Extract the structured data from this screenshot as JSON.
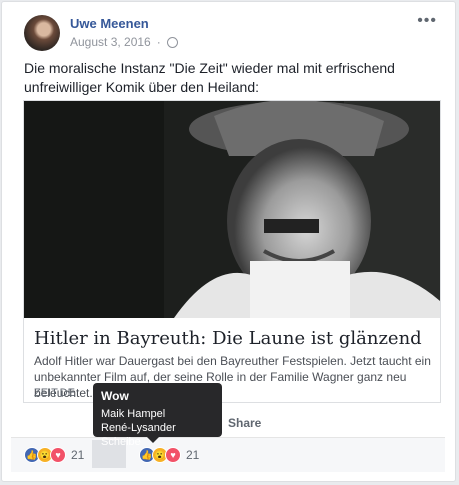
{
  "post": {
    "author": "Uwe Meenen",
    "date": "August 3, 2016",
    "text": "Die moralische Instanz \"Die Zeit\" wieder mal mit erfrischend unfreiwilliger Komik über den Heiland:"
  },
  "link": {
    "title": "Hitler in Bayreuth: Die Laune ist glänzend",
    "description": "Adolf Hitler war Dauergast bei den Bayreuther Festspielen. Jetzt taucht ein unbekannter Film auf, der seine Rolle in der Familie Wagner ganz neu beleuchtet.",
    "domain": "ZEIT.DE"
  },
  "actions": {
    "share": "Share"
  },
  "reactions": {
    "count": "21",
    "icons": [
      "like-icon",
      "wow-icon",
      "love-icon"
    ]
  },
  "tooltip": {
    "title": "Wow",
    "names": [
      "Maik Hampel",
      "René-Lysander Scheibe"
    ]
  },
  "colors": {
    "author_link": "#365899",
    "like": "#4267b2",
    "love": "#f25268",
    "wow": "#f7b125"
  }
}
